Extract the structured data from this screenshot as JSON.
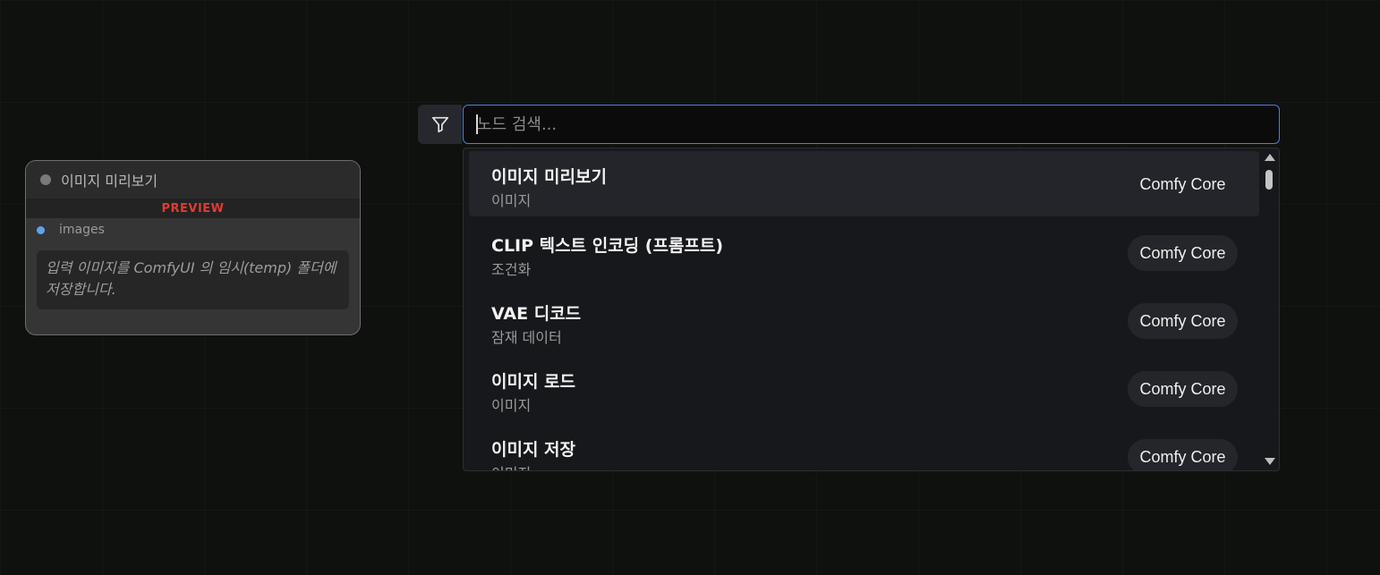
{
  "node": {
    "title": "이미지 미리보기",
    "badge": "PREVIEW",
    "input_slot": "images",
    "description": "입력 이미지를 ComfyUI 의 임시(temp) 폴더에 저장합니다."
  },
  "search": {
    "placeholder": "노드 검색...",
    "value": "",
    "filter_icon": "filter-icon"
  },
  "results": [
    {
      "name": "이미지 미리보기",
      "category": "이미지",
      "source": "Comfy Core"
    },
    {
      "name": "CLIP 텍스트 인코딩 (프롬프트)",
      "category": "조건화",
      "source": "Comfy Core"
    },
    {
      "name": "VAE 디코드",
      "category": "잠재 데이터",
      "source": "Comfy Core"
    },
    {
      "name": "이미지 로드",
      "category": "이미지",
      "source": "Comfy Core"
    },
    {
      "name": "이미지 저장",
      "category": "이미지",
      "source": "Comfy Core"
    }
  ],
  "colors": {
    "accent": "#4c7ee0",
    "preview_badge": "#e03b33",
    "slot_dot": "#5aa6e8"
  }
}
